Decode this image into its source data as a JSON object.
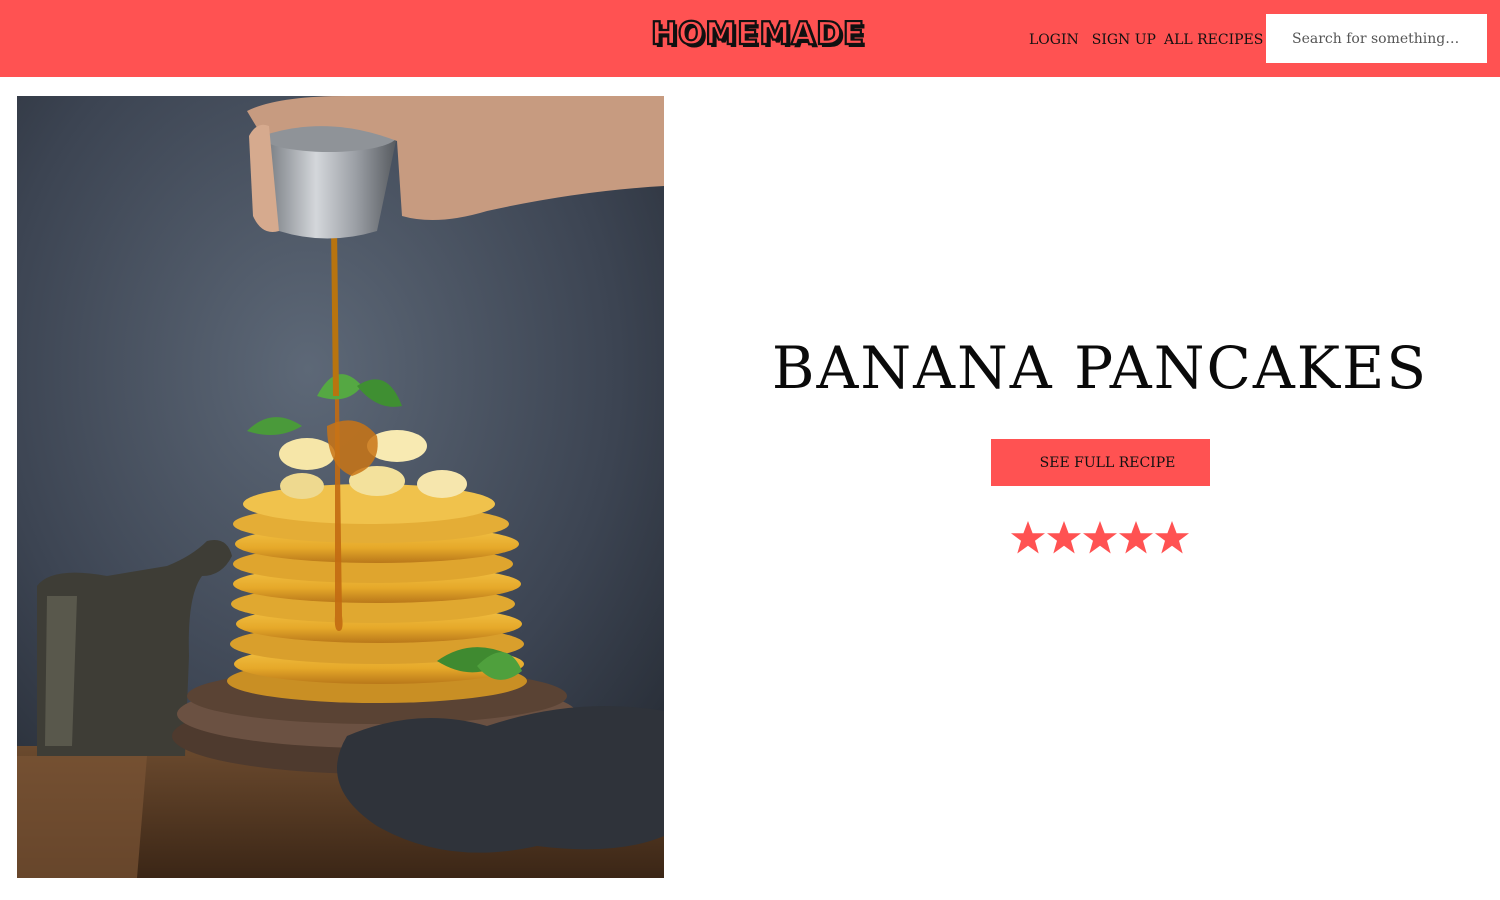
{
  "header": {
    "logo": "HOMEMADE",
    "nav": {
      "login": "LOGIN",
      "signup": "SIGN UP",
      "all_recipes": "ALL RECIPES"
    },
    "search": {
      "placeholder": "Search for something…",
      "value": ""
    }
  },
  "hero": {
    "image_alt": "Stack of banana pancakes with syrup pour",
    "title": "BANANA PANCAKES",
    "cta_label": "SEE FULL RECIPE",
    "rating": {
      "value": 5,
      "max": 5,
      "star_icon": "star-icon"
    }
  },
  "colors": {
    "accent": "#ff5252",
    "text": "#0a0a0a",
    "background": "#ffffff"
  }
}
